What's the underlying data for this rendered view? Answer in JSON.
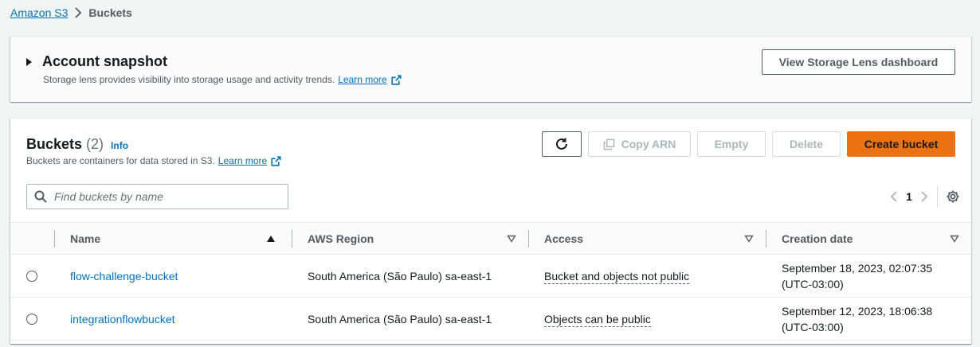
{
  "breadcrumb": {
    "root": "Amazon S3",
    "current": "Buckets"
  },
  "snapshot": {
    "title": "Account snapshot",
    "description": "Storage lens provides visibility into storage usage and activity trends.",
    "learn_more": "Learn more",
    "dashboard_button": "View Storage Lens dashboard"
  },
  "buckets": {
    "title": "Buckets",
    "count": "(2)",
    "info": "Info",
    "description": "Buckets are containers for data stored in S3.",
    "learn_more": "Learn more",
    "actions": {
      "copy_arn": "Copy ARN",
      "empty": "Empty",
      "delete": "Delete",
      "create": "Create bucket"
    },
    "search_placeholder": "Find buckets by name",
    "page": "1",
    "columns": {
      "name": "Name",
      "region": "AWS Region",
      "access": "Access",
      "created": "Creation date"
    },
    "rows": [
      {
        "name": "flow-challenge-bucket",
        "region": "South America (São Paulo) sa-east-1",
        "access": "Bucket and objects not public",
        "date_line1": "September 18, 2023, 02:07:35",
        "date_line2": "(UTC-03:00)"
      },
      {
        "name": "integrationflowbucket",
        "region": "South America (São Paulo) sa-east-1",
        "access": "Objects can be public",
        "date_line1": "September 12, 2023, 18:06:38",
        "date_line2": "(UTC-03:00)"
      }
    ]
  },
  "colors": {
    "link": "#0073bb",
    "primary": "#ec7211"
  }
}
